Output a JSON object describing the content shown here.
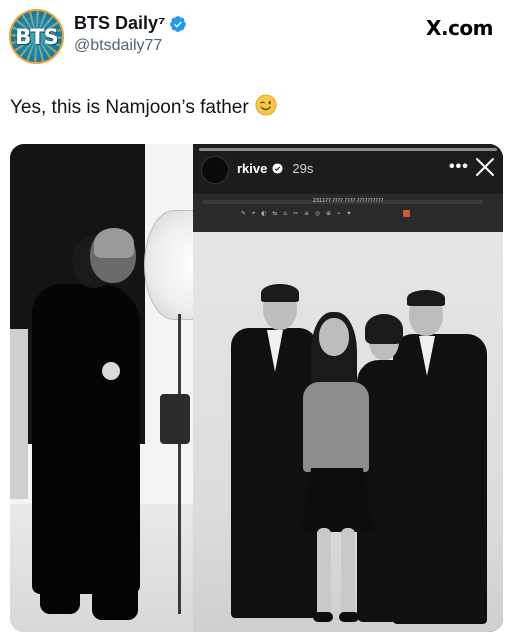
{
  "account": {
    "display_name": "BTS Daily⁷",
    "handle": "@btsdaily77",
    "avatar_text": "BTS",
    "verified": true
  },
  "brand": {
    "label": "X.com"
  },
  "tweet": {
    "text": "Yes, this is Namjoon’s father",
    "emoji": "winking-face"
  },
  "media": {
    "story": {
      "username": "rkive",
      "time": "29s",
      "more_label": "•••",
      "monitor_title": "2311?? ???? ???? ??????????",
      "monitor_icons": "✎ ⌖ ◐ ⇆ ⌂ ✂ ≡ ◎ ⊕ ⌁ ✦"
    }
  },
  "colors": {
    "verified": "#1d9bf0",
    "text": "#0f1419",
    "secondary": "#536471"
  }
}
